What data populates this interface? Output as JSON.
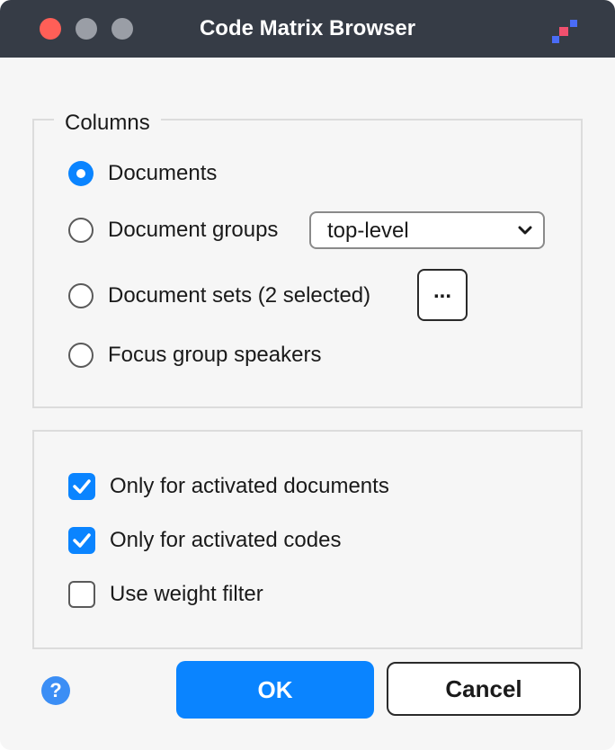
{
  "window": {
    "title": "Code Matrix Browser"
  },
  "columns": {
    "legend": "Columns",
    "options": [
      {
        "label": "Documents",
        "checked": true
      },
      {
        "label": "Document groups",
        "checked": false
      },
      {
        "label": "Document sets (2 selected)",
        "checked": false
      },
      {
        "label": "Focus group speakers",
        "checked": false
      }
    ],
    "group_select": {
      "value": "top-level"
    },
    "sets_button": {
      "label": "..."
    }
  },
  "filters": {
    "items": [
      {
        "label": "Only for activated documents",
        "checked": true
      },
      {
        "label": "Only for activated codes",
        "checked": true
      },
      {
        "label": "Use weight filter",
        "checked": false
      }
    ]
  },
  "footer": {
    "help_label": "?",
    "ok_label": "OK",
    "cancel_label": "Cancel"
  },
  "colors": {
    "accent": "#0a84ff",
    "titlebar": "#363c46",
    "close": "#ff5f57"
  },
  "icons": {
    "app_logo": "maxqda-logo-icon",
    "chevron": "chevron-down-icon",
    "checkmark": "checkmark-icon",
    "help": "help-icon"
  }
}
